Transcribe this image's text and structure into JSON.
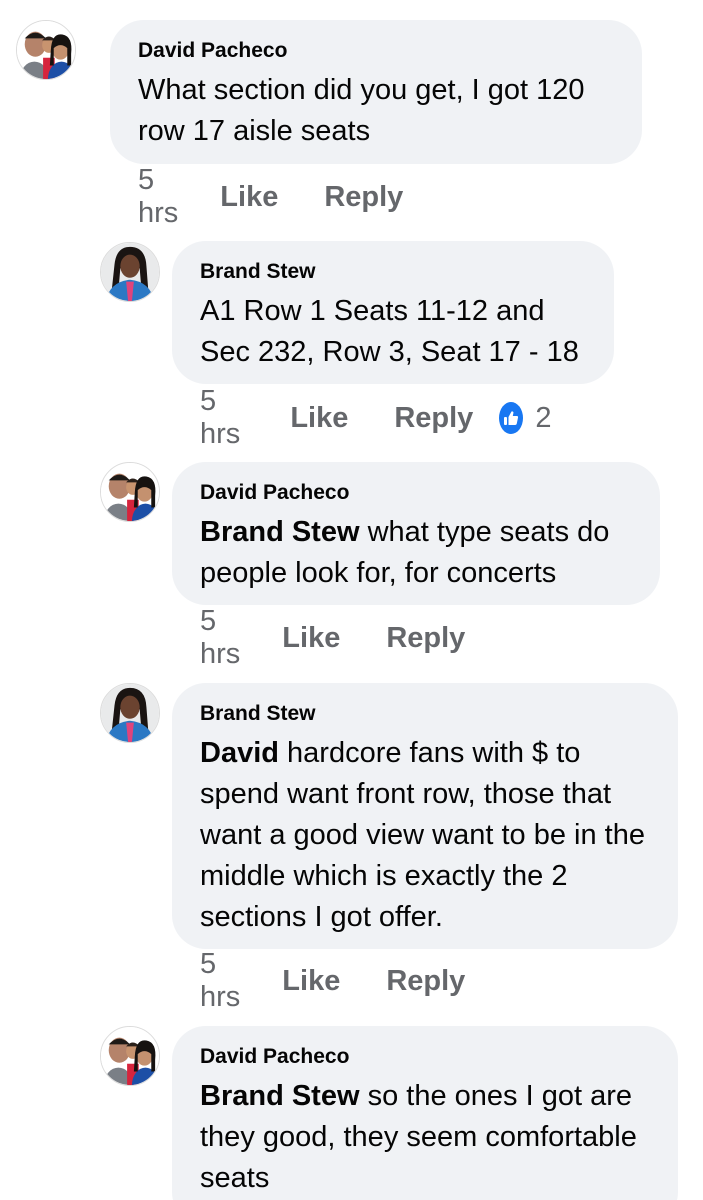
{
  "comments": [
    {
      "author": "David Pacheco",
      "mention": "",
      "text": "What section did you get, I got 120 row 17 aisle seats",
      "time": "5 hrs",
      "like": "Like",
      "reply": "Reply",
      "reactions": null,
      "avatar": "david-family-photo"
    },
    {
      "author": "Brand Stew",
      "mention": "",
      "text": "A1 Row 1 Seats 11-12 and Sec 232, Row 3, Seat 17 - 18",
      "time": "5 hrs",
      "like": "Like",
      "reply": "Reply",
      "reactions": "2",
      "avatar": "brand-stew-photo"
    },
    {
      "author": "David Pacheco",
      "mention": "Brand Stew",
      "text": " what type seats do people look for, for concerts",
      "time": "5 hrs",
      "like": "Like",
      "reply": "Reply",
      "reactions": null,
      "avatar": "david-family-photo"
    },
    {
      "author": "Brand Stew",
      "mention": "David",
      "text": " hardcore fans with $ to spend want front row, those that want a good view want to be in the middle which is exactly the 2 sections I got offer.",
      "time": "5 hrs",
      "like": "Like",
      "reply": "Reply",
      "reactions": null,
      "avatar": "brand-stew-photo"
    },
    {
      "author": "David Pacheco",
      "mention": "Brand Stew",
      "text": " so the ones I got are they good, they seem comfortable seats",
      "time": "",
      "like": "",
      "reply": "",
      "reactions": null,
      "avatar": "david-family-photo"
    }
  ],
  "colors": {
    "bubble": "#f0f2f5",
    "meta_text": "#65676b",
    "like_reaction": "#1877f2"
  },
  "icons": {
    "reaction": "thumbs-up-icon"
  }
}
